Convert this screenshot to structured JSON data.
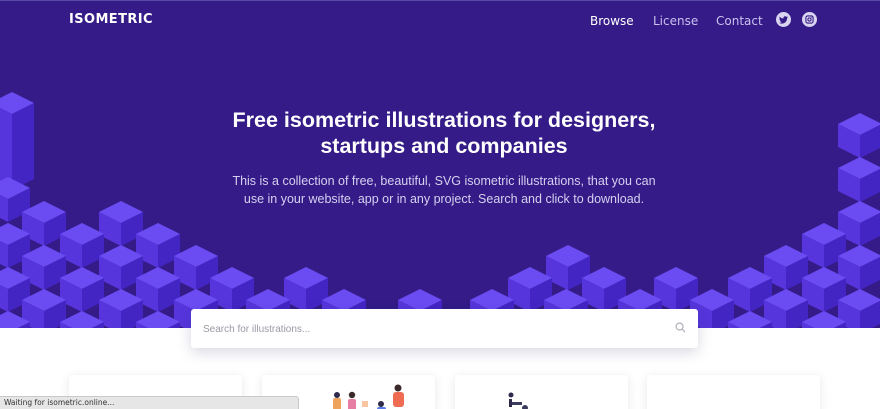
{
  "nav": {
    "logo": "ISOMETRIC",
    "links": [
      "Browse",
      "License",
      "Contact"
    ],
    "social": [
      "twitter-icon",
      "instagram-icon"
    ]
  },
  "hero": {
    "title": "Free isometric illustrations for designers, startups and companies",
    "subtitle": "This is a collection of free, beautiful, SVG isometric illustrations, that you can use in your website, app or in any project. Search and click to download."
  },
  "search": {
    "placeholder": "Search for illustrations...",
    "icon": "search-icon"
  },
  "status_bar": {
    "text": "Waiting for isometric.online..."
  },
  "colors": {
    "hero_background": "#341b87",
    "cube_top": "#6b4cf3",
    "cube_left": "#5636dc",
    "cube_right": "#4325c4",
    "white": "#ffffff"
  }
}
